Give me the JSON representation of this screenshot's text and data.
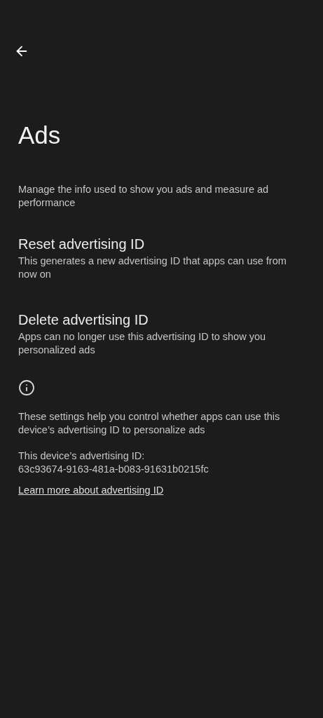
{
  "title": "Ads",
  "description": "Manage the info used to show you ads and measure ad performance",
  "items": [
    {
      "title": "Reset advertising ID",
      "summary": "This generates a new advertising ID that apps can use from now on"
    },
    {
      "title": "Delete advertising ID",
      "summary": "Apps can no longer use this advertising ID to show you personalized ads"
    }
  ],
  "footer": {
    "text": "These settings help you control whether apps can use this device’s advertising ID to personalize ads",
    "id_label": "This device’s advertising ID:",
    "id_value": "63c93674-9163-481a-b083-91631b0215fc",
    "link": "Learn more about advertising ID"
  }
}
